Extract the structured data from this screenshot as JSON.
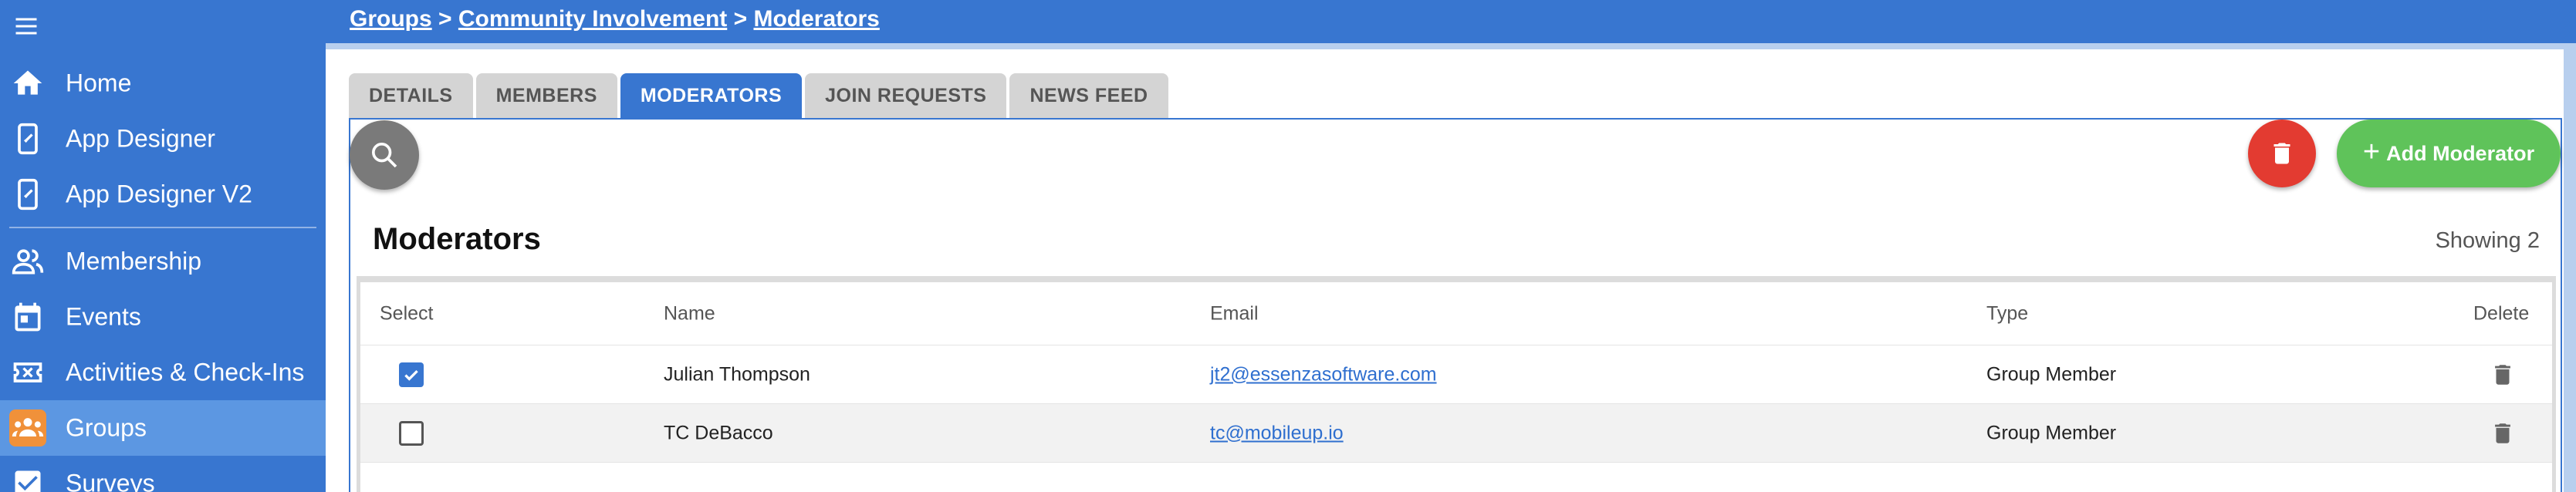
{
  "breadcrumb": {
    "groups": "Groups",
    "sep1": " > ",
    "group": "Community Involvement",
    "sep2": " > ",
    "current": "Moderators"
  },
  "sidebar": {
    "items": [
      {
        "label": "Home",
        "icon": "home-icon"
      },
      {
        "label": "App Designer",
        "icon": "phone-edit-icon"
      },
      {
        "label": "App Designer V2",
        "icon": "phone-edit-icon"
      },
      {
        "label": "Membership",
        "icon": "people-icon"
      },
      {
        "label": "Events",
        "icon": "calendar-icon"
      },
      {
        "label": "Activities & Check-Ins",
        "icon": "ticket-icon"
      },
      {
        "label": "Groups",
        "icon": "groups-icon",
        "active": true
      },
      {
        "label": "Surveys",
        "icon": "checkbox-icon"
      }
    ]
  },
  "tabs": [
    {
      "label": "DETAILS"
    },
    {
      "label": "MEMBERS"
    },
    {
      "label": "MODERATORS",
      "active": true
    },
    {
      "label": "JOIN REQUESTS"
    },
    {
      "label": "NEWS FEED"
    }
  ],
  "actions": {
    "add_label": "Add Moderator"
  },
  "section": {
    "title": "Moderators",
    "showing": "Showing 2"
  },
  "table": {
    "headers": {
      "select": "Select",
      "name": "Name",
      "email": "Email",
      "type": "Type",
      "delete": "Delete"
    },
    "rows": [
      {
        "selected": true,
        "name": "Julian Thompson",
        "email": "jt2@essenzasoftware.com",
        "type": "Group Member"
      },
      {
        "selected": false,
        "name": "TC DeBacco",
        "email": "tc@mobileup.io",
        "type": "Group Member"
      }
    ]
  },
  "colors": {
    "primary": "#3876d0",
    "active_nav": "#5c97e2",
    "active_icon_bg": "#f0913a",
    "delete_red": "#e33b31",
    "add_green": "#5fc35a"
  }
}
